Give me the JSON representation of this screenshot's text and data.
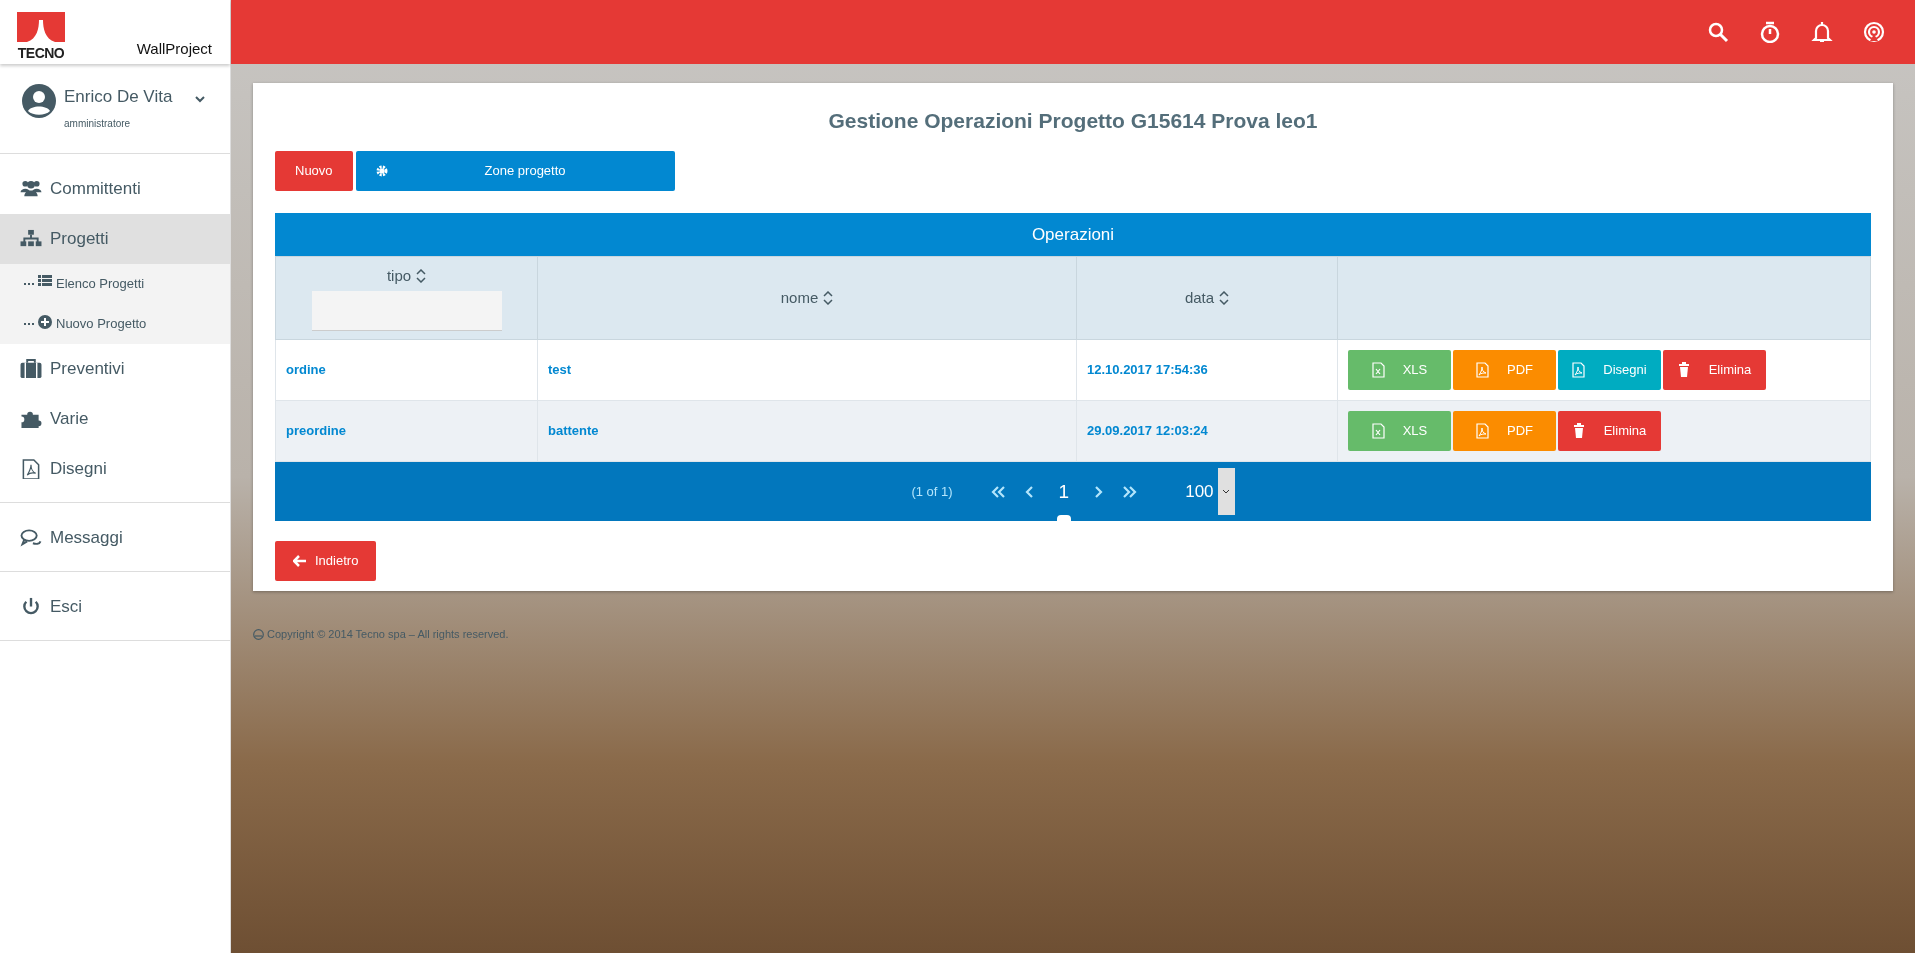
{
  "brand": {
    "logo_text": "TECNO",
    "app_name": "WallProject"
  },
  "topbar": {
    "icons": [
      {
        "kind": "search"
      },
      {
        "kind": "timer"
      },
      {
        "kind": "bell"
      },
      {
        "kind": "broadcast"
      }
    ]
  },
  "user": {
    "name": "Enrico De Vita",
    "role": "amministratore",
    "expanded": false
  },
  "sidebar": {
    "groups": [
      [
        {
          "label": "Committenti",
          "selected": false
        },
        {
          "label": "Progetti",
          "selected": true,
          "expanded": true,
          "children": [
            {
              "label": "Elenco Progetti"
            },
            {
              "label": "Nuovo Progetto"
            }
          ]
        },
        {
          "label": "Preventivi",
          "selected": false
        },
        {
          "label": "Varie",
          "selected": false
        },
        {
          "label": "Disegni",
          "selected": false
        }
      ],
      [
        {
          "label": "Messaggi",
          "selected": false
        }
      ],
      [
        {
          "label": "Esci",
          "selected": false
        }
      ]
    ]
  },
  "page": {
    "title": "Gestione Operazioni Progetto G15614 Prova leo1",
    "toolbar": [
      {
        "label": "Nuovo",
        "kind": "new"
      },
      {
        "label": "Zone progetto",
        "kind": "zones"
      }
    ],
    "table": {
      "caption": "Operazioni",
      "columns": [
        {
          "label": "tipo",
          "sortable": true,
          "filter": true
        },
        {
          "label": "nome",
          "sortable": true,
          "filter": false
        },
        {
          "label": "data",
          "sortable": true,
          "filter": false
        }
      ],
      "rows": [
        {
          "tipo": "ordine",
          "nome": "test",
          "data": "12.10.2017 17:54:36",
          "actions": [
            {
              "label": "XLS",
              "kind": "xls"
            },
            {
              "label": "PDF",
              "kind": "pdf"
            },
            {
              "label": "Disegni",
              "kind": "drawings"
            },
            {
              "label": "Elimina",
              "kind": "delete"
            }
          ]
        },
        {
          "tipo": "preordine",
          "nome": "battente",
          "data": "29.09.2017 12:03:24",
          "actions": [
            {
              "label": "XLS",
              "kind": "xls"
            },
            {
              "label": "PDF",
              "kind": "pdf"
            },
            {
              "label": "Elimina",
              "kind": "delete"
            }
          ]
        }
      ],
      "paginator": {
        "summary": "(1 of 1)",
        "pages": [
          {
            "label": "1",
            "selected": true
          }
        ],
        "rows_per_page": "100"
      }
    },
    "back_button": "Indietro"
  },
  "footer": "Copyright © 2014 Tecno spa – All rights reserved."
}
